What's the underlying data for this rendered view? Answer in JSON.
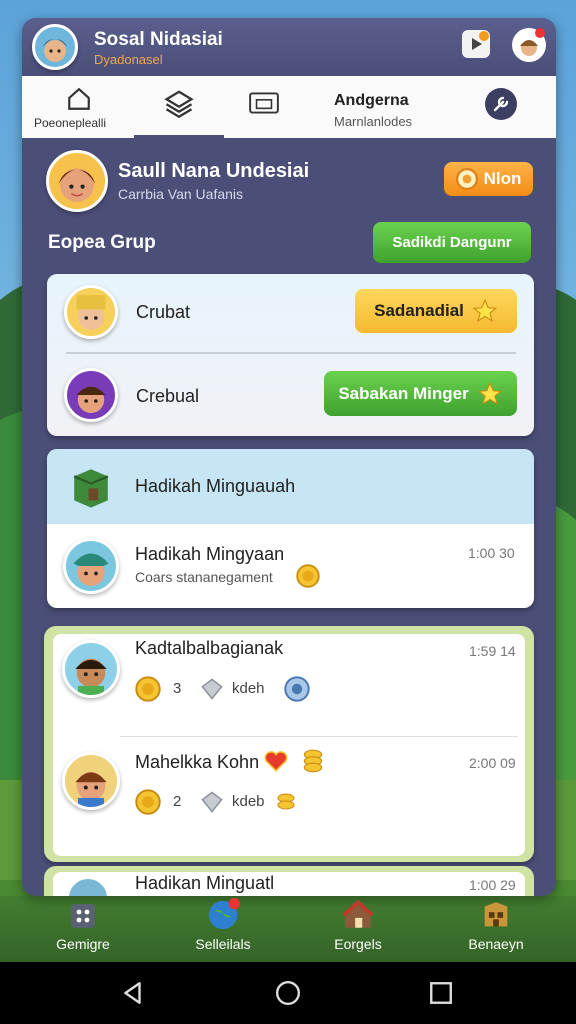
{
  "header": {
    "title": "Sosal Nidasiai",
    "subtitle": "Dyadonasel"
  },
  "tabs": [
    {
      "label": "Poeoneplealli"
    },
    {
      "label": ""
    },
    {
      "label": ""
    },
    {
      "label": "Andgerna",
      "sublabel": "Marnlanlodes"
    }
  ],
  "profile": {
    "name": "Saull Nana Undesiai",
    "subtitle": "Carrbia Van Uafanis",
    "badge_label": "Nlon"
  },
  "group": {
    "title": "Eopea Grup",
    "action_label": "Sadikdi Dangunr"
  },
  "members": [
    {
      "name": "Crubat",
      "button_label": "Sadanadial"
    },
    {
      "name": "Crebual",
      "button_label": "Sabakan Minger"
    }
  ],
  "reward_card": {
    "title": "Hadikah Minguauah",
    "item": {
      "title": "Hadikah Mingyaan",
      "subtitle": "Coars stananegament",
      "time": "1:00 30"
    }
  },
  "friends": [
    {
      "name": "Kadtalbalbagianak",
      "time": "1:59 14",
      "coins": "3",
      "label": "kdeh"
    },
    {
      "name": "Mahelkka Kohn",
      "time": "2:00 09",
      "coins": "2",
      "label": "kdeb"
    }
  ],
  "partial": {
    "name": "Hadikan Minguatl",
    "time": "1:00 29"
  },
  "bottom_nav": [
    {
      "label": "Gemigre"
    },
    {
      "label": "Selleilals"
    },
    {
      "label": "Eorgels"
    },
    {
      "label": "Benaeyn"
    }
  ],
  "colors": {
    "panel": "#4b4f78",
    "accent_orange": "#f7a425",
    "accent_green": "#4fb53a",
    "accent_yellow": "#fbcf3c",
    "card_blue": "#c6e6f5"
  }
}
